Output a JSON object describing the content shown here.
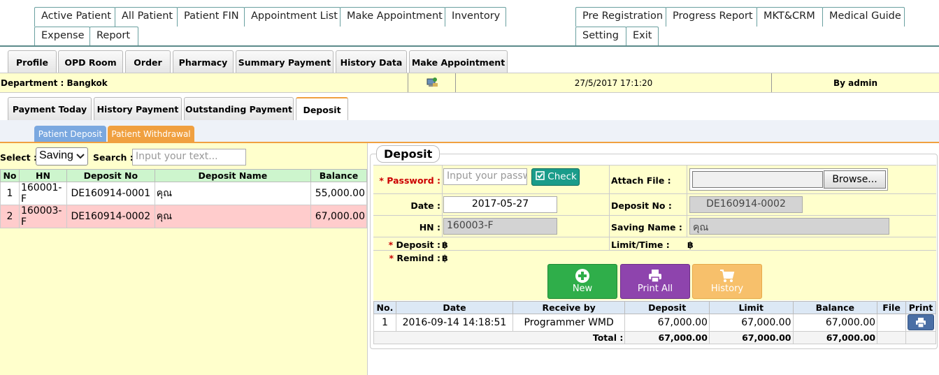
{
  "top_menu": {
    "left": [
      "Active Patient",
      "All Patient",
      "Patient FIN",
      "Appointment List",
      "Make Appointment",
      "Inventory",
      "Expense",
      "Report"
    ],
    "right": [
      "Pre Registration",
      "Progress Report",
      "MKT&CRM",
      "Medical Guide",
      "Setting",
      "Exit"
    ]
  },
  "patient_tabs": [
    "Profile",
    "OPD Room",
    "Order",
    "Pharmacy",
    "Summary Payment",
    "History Data",
    "Make Appointment"
  ],
  "dept_bar": {
    "department": "Department : Bangkok",
    "datetime": "27/5/2017 17:1:20",
    "user": "By admin"
  },
  "payment_tabs": [
    "Payment Today",
    "History Payment",
    "Outstanding Payment",
    "Deposit"
  ],
  "sub_tabs": {
    "deposit": "Patient Deposit",
    "withdrawal": "Patient Withdrawal"
  },
  "colors": {
    "accent_orange": "#f0a040",
    "sub_blue": "#7aa8e0",
    "new_green": "#2fae4a",
    "print_purple": "#8e44ad",
    "history_orange": "#f7c06b"
  },
  "left": {
    "select_label": "Select :",
    "select_value": "Saving",
    "search_label": "Search :",
    "search_placeholder": "Input your text...",
    "columns": [
      "No",
      "HN",
      "Deposit No",
      "Deposit Name",
      "Balance"
    ],
    "rows": [
      {
        "no": "1",
        "hn": "160001-F",
        "deposit_no": "DE160914-0001",
        "name": "คุณ",
        "balance": "55,000.00"
      },
      {
        "no": "2",
        "hn": "160003-F",
        "deposit_no": "DE160914-0002",
        "name": "คุณ",
        "balance": "67,000.00"
      }
    ]
  },
  "deposit_form": {
    "legend": "Deposit",
    "password_label": "Password :",
    "password_placeholder": "Input your password",
    "check_button": "Check",
    "attach_label": "Attach File :",
    "browse_button": "Browse...",
    "date_label": "Date :",
    "date_value": "2017-05-27",
    "deposit_no_label": "Deposit No :",
    "deposit_no_value": "DE160914-0002",
    "hn_label": "HN :",
    "hn_value": "160003-F",
    "saving_name_label": "Saving Name :",
    "saving_name_value": "คุณ",
    "deposit_label": "Deposit :",
    "deposit_value": "฿",
    "limit_label": "Limit/Time :",
    "limit_value": "฿",
    "remind_label": "Remind :",
    "remind_value": "฿",
    "required_mark": "*",
    "buttons": {
      "new": "New",
      "print_all": "Print All",
      "history": "History"
    }
  },
  "history_table": {
    "columns": [
      "No.",
      "Date",
      "Receive by",
      "Deposit",
      "Limit",
      "Balance",
      "File",
      "Print"
    ],
    "rows": [
      {
        "no": "1",
        "date": "2016-09-14 14:18:51",
        "receive_by": "Programmer WMD",
        "deposit": "67,000.00",
        "limit": "67,000.00",
        "balance": "67,000.00",
        "file": ""
      }
    ],
    "total_label": "Total :",
    "total_deposit": "67,000.00",
    "total_limit": "67,000.00",
    "total_balance": "67,000.00"
  }
}
